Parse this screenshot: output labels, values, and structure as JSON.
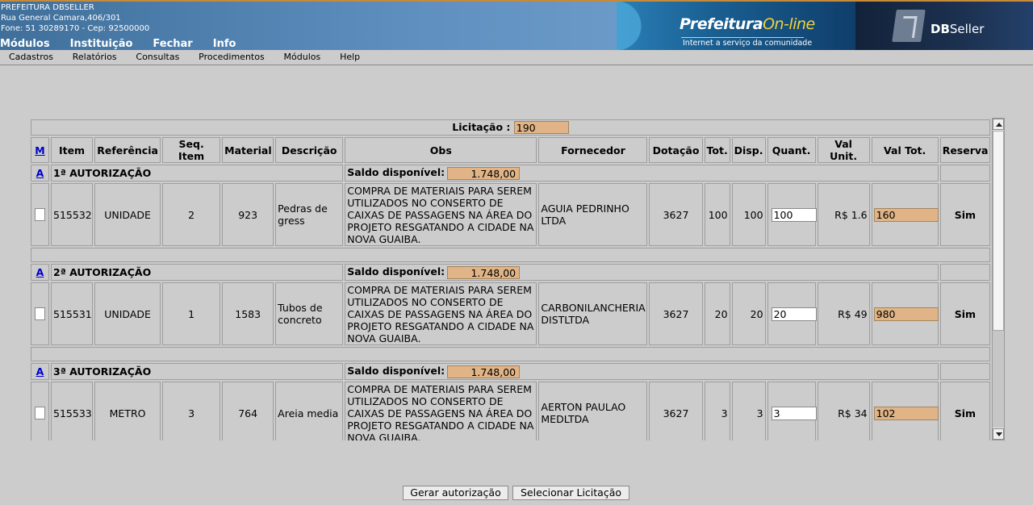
{
  "header": {
    "org_name": "PREFEITURA DBSELLER",
    "address": "Rua General Camara,406/301",
    "phone_line": "Fone: 51 30289170  -  Cep: 92500000",
    "nav": [
      "Módulos",
      "Instituição",
      "Fechar",
      "Info"
    ],
    "banner_title_main": "Prefeitura",
    "banner_title_accent": "On-line",
    "banner_subtitle": "Internet a serviço da comunidade",
    "dbseller_bold": "DB",
    "dbseller_rest": "Seller"
  },
  "menubar": [
    "Cadastros",
    "Relatórios",
    "Consultas",
    "Procedimentos",
    "Módulos",
    "Help"
  ],
  "licitacao": {
    "label": "Licitação :",
    "value": "190"
  },
  "columns": {
    "m": "M",
    "item": "Item",
    "referencia": "Referência",
    "seq": "Seq. Item",
    "material": "Material",
    "descricao": "Descrição",
    "obs": "Obs",
    "fornecedor": "Fornecedor",
    "dotacao": "Dotação",
    "tot": "Tot.",
    "disp": "Disp.",
    "quant": "Quant.",
    "val_unit": "Val Unit.",
    "val_tot": "Val Tot.",
    "reserva": "Reserva"
  },
  "saldo_label": "Saldo disponível:",
  "authorizations": [
    {
      "link": "A",
      "title": "1ª AUTORIZAÇÃO",
      "saldo": "1.748,00",
      "row": {
        "item": "515532",
        "referencia": "UNIDADE",
        "seq": "2",
        "material": "923",
        "descricao": "Pedras de gress",
        "obs": "COMPRA DE MATERIAIS PARA SEREM UTILIZADOS NO CONSERTO DE CAIXAS DE PASSAGENS NA ÁREA DO PROJETO RESGATANDO A CIDADE NA NOVA GUAIBA.",
        "fornecedor": "AGUIA PEDRINHO LTDA",
        "dotacao": "3627",
        "tot": "100",
        "disp": "100",
        "quant": "100",
        "val_unit": "R$ 1.6",
        "val_tot": "160",
        "reserva": "Sim"
      }
    },
    {
      "link": "A",
      "title": "2ª AUTORIZAÇÃO",
      "saldo": "1.748,00",
      "row": {
        "item": "515531",
        "referencia": "UNIDADE",
        "seq": "1",
        "material": "1583",
        "descricao": "Tubos de concreto",
        "obs": "COMPRA DE MATERIAIS PARA SEREM UTILIZADOS NO CONSERTO DE CAIXAS DE PASSAGENS NA ÁREA DO PROJETO RESGATANDO A CIDADE NA NOVA GUAIBA.",
        "fornecedor": "CARBONILANCHERIA DISTLTDA",
        "dotacao": "3627",
        "tot": "20",
        "disp": "20",
        "quant": "20",
        "val_unit": "R$ 49",
        "val_tot": "980",
        "reserva": "Sim"
      }
    },
    {
      "link": "A",
      "title": "3ª AUTORIZAÇÃO",
      "saldo": "1.748,00",
      "row": {
        "item": "515533",
        "referencia": "METRO",
        "seq": "3",
        "material": "764",
        "descricao": "Areia media",
        "obs": "COMPRA DE MATERIAIS PARA SEREM UTILIZADOS NO CONSERTO DE CAIXAS DE PASSAGENS NA ÁREA DO PROJETO RESGATANDO A CIDADE NA NOVA GUAIBA.",
        "fornecedor": "AERTON PAULAO MEDLTDA",
        "dotacao": "3627",
        "tot": "3",
        "disp": "3",
        "quant": "3",
        "val_unit": "R$ 34",
        "val_tot": "102",
        "reserva": "Sim"
      }
    }
  ],
  "buttons": {
    "gerar": "Gerar autorização",
    "selecionar": "Selecionar Licitação"
  }
}
